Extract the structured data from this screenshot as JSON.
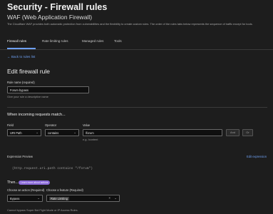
{
  "header": {
    "title": "Security - Firewall rules",
    "subtitle": "WAF (Web Application Firewall)",
    "description": "The Cloudflare WAF provides both automatic protection from vulnerabilities and the flexibility to create custom rules. The order of the rules tabs below represents the sequence of traffic except for tools."
  },
  "tabs": [
    {
      "label": "Firewall rules",
      "active": true
    },
    {
      "label": "Rate limiting rules",
      "active": false
    },
    {
      "label": "Managed rules",
      "active": false
    },
    {
      "label": "Tools",
      "active": false
    }
  ],
  "nav": {
    "back_label": "Back to rules list"
  },
  "form": {
    "heading": "Edit firewall rule",
    "rule_name": {
      "label": "Rule name (required)",
      "value": "Forum bypass",
      "hint": "Give your rule a descriptive name"
    },
    "match_heading": "When incoming requests match...",
    "field": {
      "label": "Field",
      "value": "URI Path"
    },
    "operator": {
      "label": "Operator",
      "value": "contains"
    },
    "value": {
      "label": "Value",
      "value": "/forum",
      "hint": "e.g. /content"
    },
    "and_button": "And",
    "or_button": "Or",
    "expression_preview_label": "Expression Preview",
    "edit_expression_link": "Edit expression",
    "expression": "(http.request.uri.path contains \"/forum\")",
    "then_heading": "Then...",
    "then_badge": "Learn more about actions",
    "action": {
      "label": "Choose an action (Required)",
      "value": "Bypass"
    },
    "feature": {
      "label": "Choose a feature (Required)",
      "value": "Rate Limiting"
    },
    "footnote": "Cannot bypass Super Bot Fight Mode or IP Access Rules."
  },
  "colors": {
    "accent": "#6ea0f2",
    "badge": "#8a6ad8",
    "background": "#1d1d1d"
  },
  "icons": {
    "back": "arrow-left-icon",
    "chevron": "chevron-down-icon",
    "close": "close-icon"
  }
}
